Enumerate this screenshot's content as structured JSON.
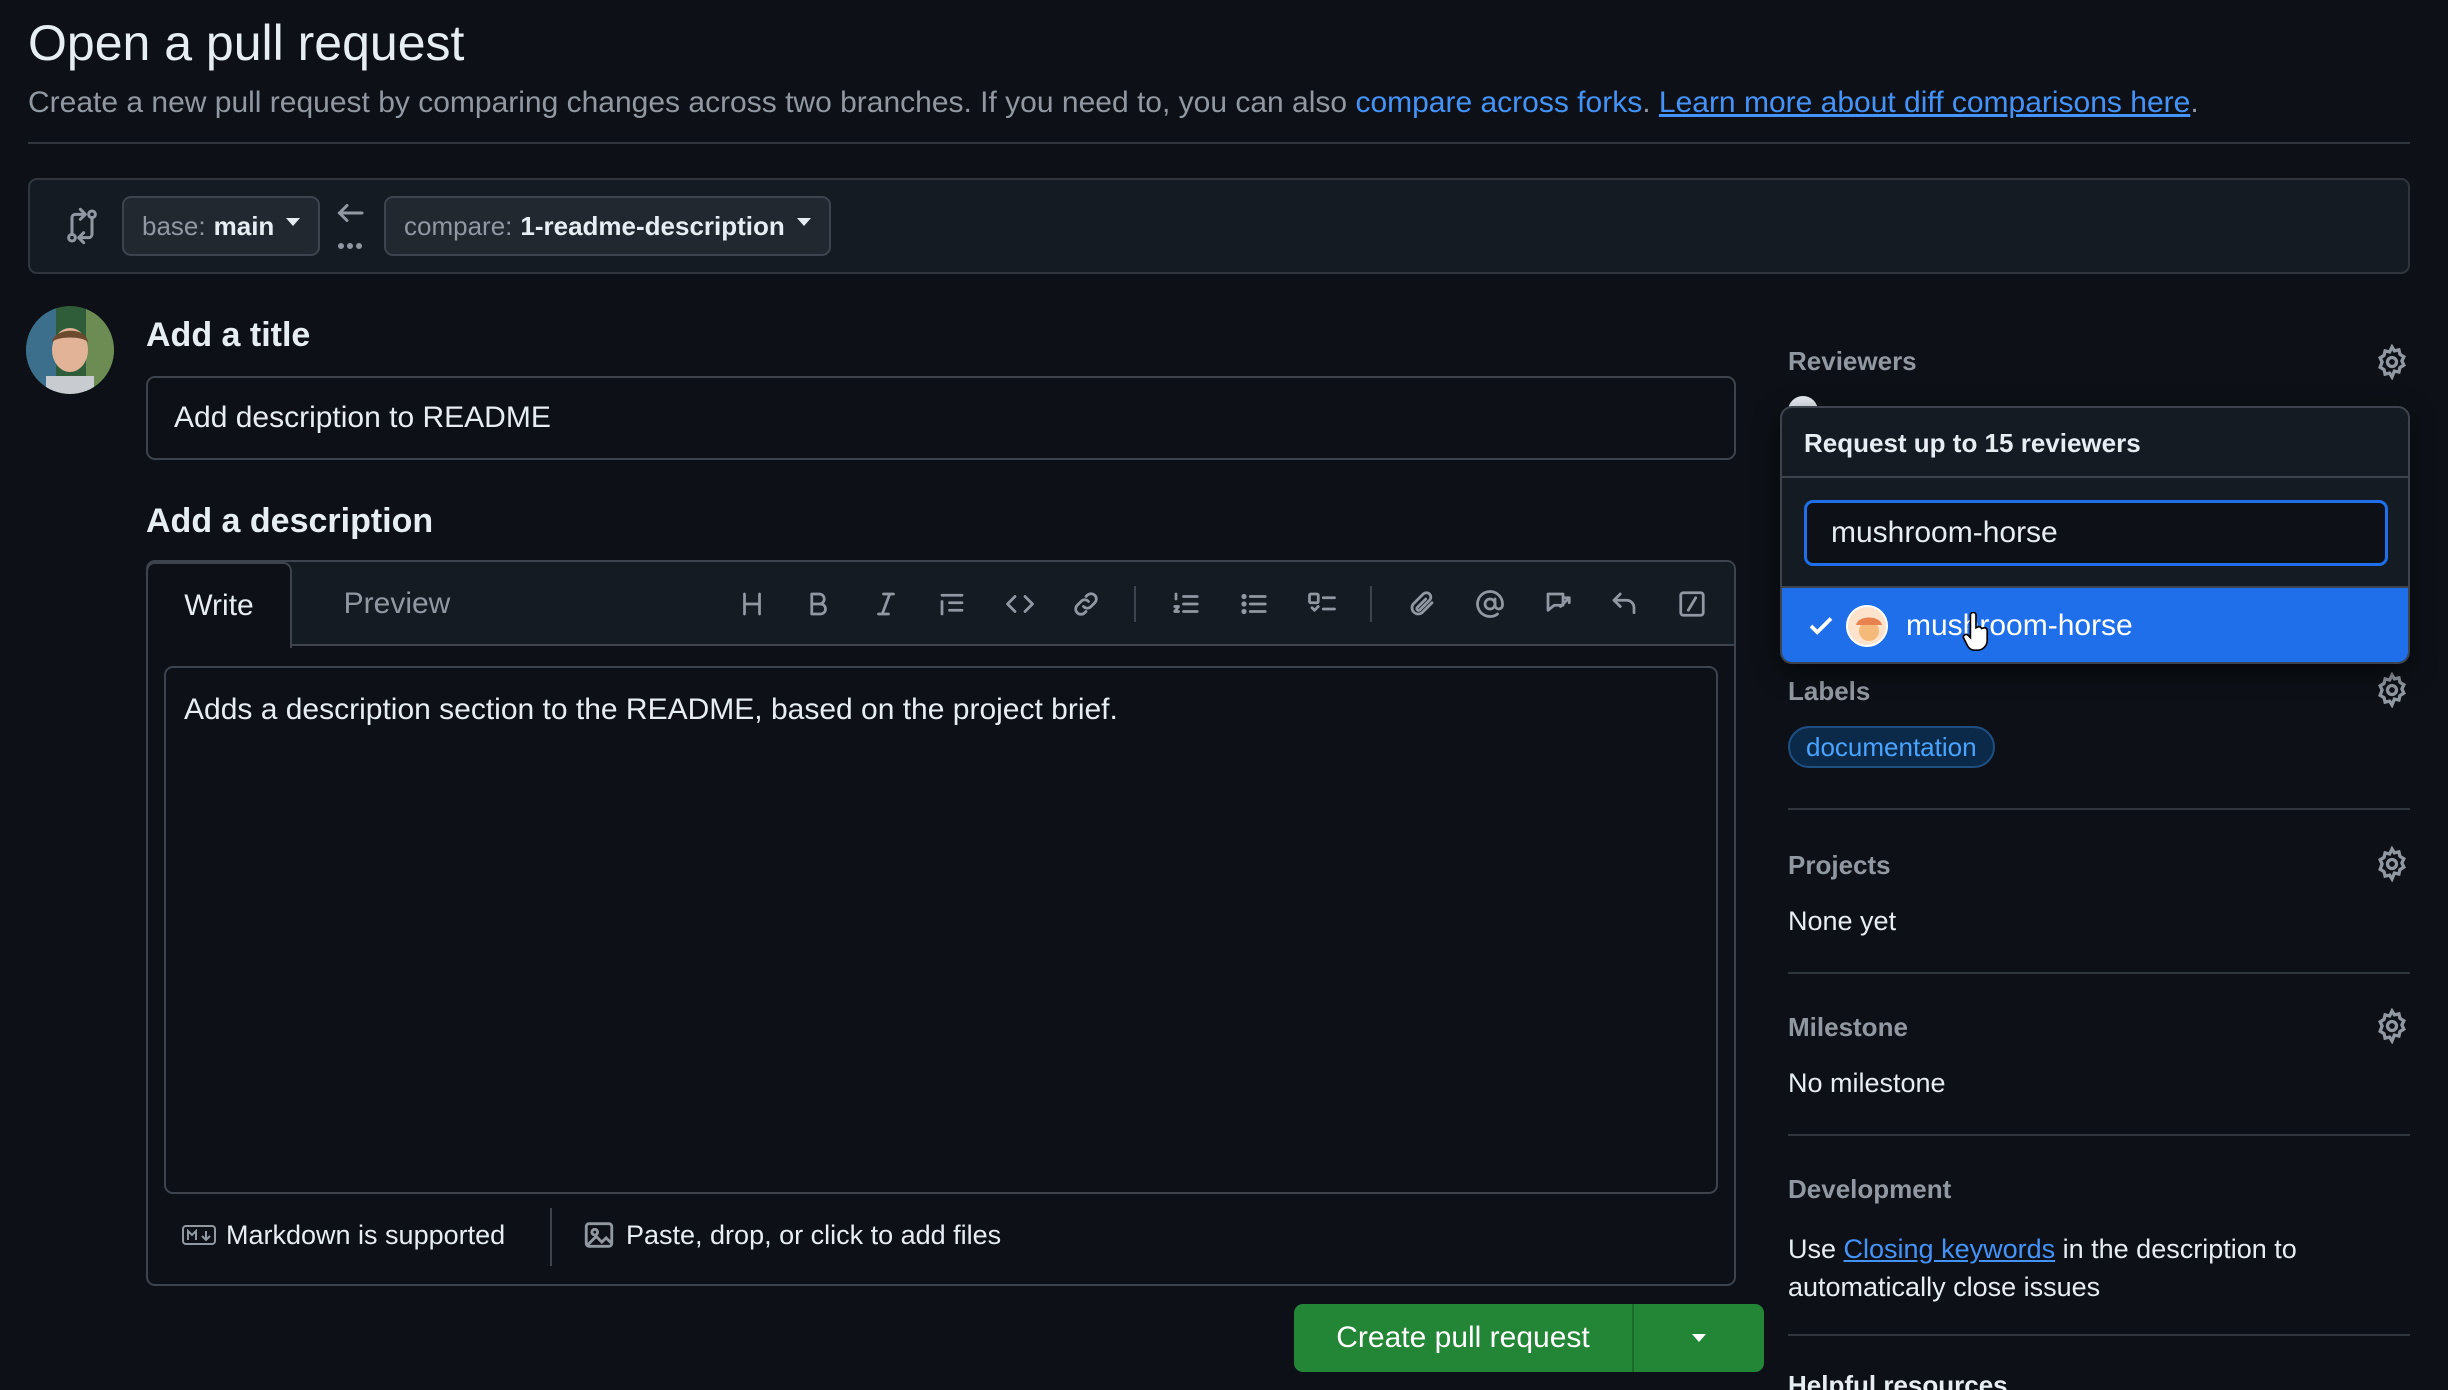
{
  "header": {
    "title": "Open a pull request",
    "subtitle_text": "Create a new pull request by comparing changes across two branches. If you need to, you can also ",
    "compare_forks_link": "compare across forks",
    "learn_more_link": "Learn more about diff comparisons here",
    "period": "."
  },
  "range": {
    "base_prefix": "base:",
    "base_value": "main",
    "compare_prefix": "compare:",
    "compare_value": "1-readme-description"
  },
  "form": {
    "title_label": "Add a title",
    "title_value": "Add description to README",
    "description_label": "Add a description",
    "tabs": {
      "write": "Write",
      "preview": "Preview"
    },
    "description_value": "Adds a description section to the README, based on the project brief.",
    "markdown_note": "Markdown is supported",
    "files_note": "Paste, drop, or click to add files",
    "create_button": "Create pull request"
  },
  "sidebar": {
    "reviewers": {
      "heading": "Reviewers",
      "popup_title": "Request up to 15 reviewers",
      "search_value": "mushroom-horse",
      "result_name": "mushroom-horse"
    },
    "labels": {
      "heading": "Labels",
      "items": [
        "documentation"
      ]
    },
    "projects": {
      "heading": "Projects",
      "value": "None yet"
    },
    "milestone": {
      "heading": "Milestone",
      "value": "No milestone"
    },
    "development": {
      "heading": "Development",
      "text_prefix": "Use ",
      "link": "Closing keywords",
      "text_suffix": " in the description to",
      "text_line2": "automatically close issues"
    },
    "helpful": {
      "heading": "Helpful resources"
    }
  },
  "colors": {
    "background": "#0d1117",
    "accent_blue": "#1f6feb",
    "link": "#4493f8",
    "primary_green": "#238636"
  }
}
